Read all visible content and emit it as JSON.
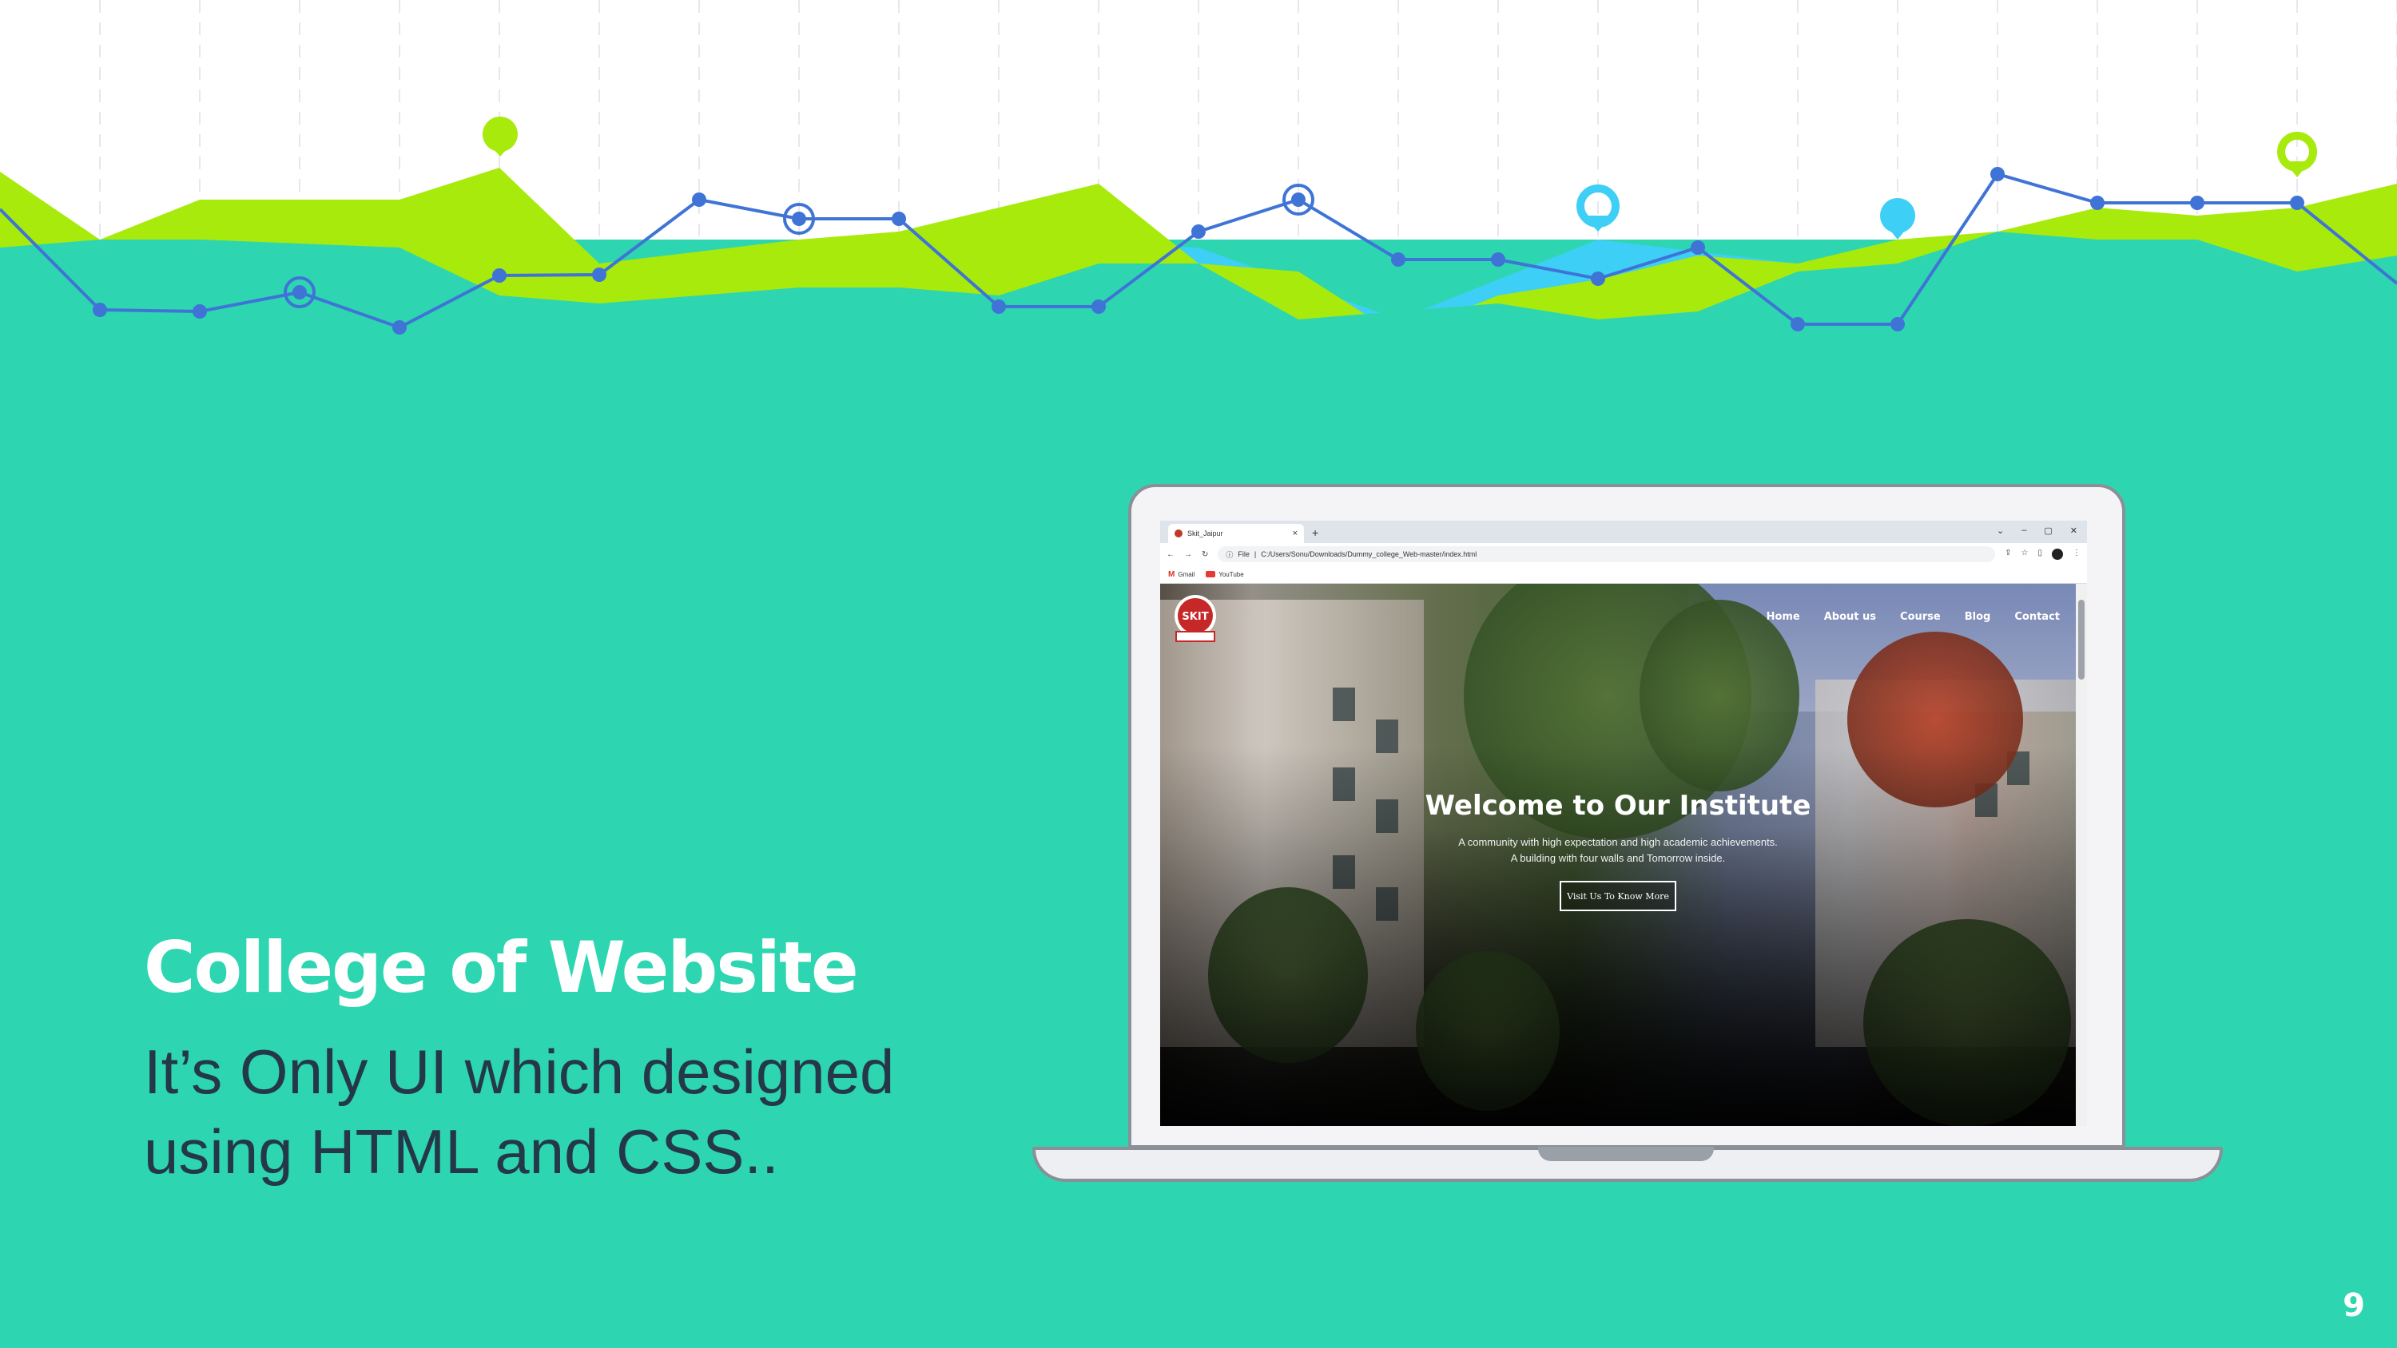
{
  "slide": {
    "title": "College of Website",
    "subtitle_line1": "It’s Only UI which designed",
    "subtitle_line2": "using HTML and CSS..",
    "page_number": "9"
  },
  "colors": {
    "background": "#2dd6b0",
    "lime": "#a8ea0b",
    "sky": "#3dcff5",
    "line": "#3f74d6",
    "subtitle_text": "#24384a"
  },
  "browser": {
    "tab_title": "Skit_Jaipur",
    "tab_close": "×",
    "new_tab": "+",
    "window_controls": [
      "⌄",
      "–",
      "▢",
      "✕"
    ],
    "address_prefix": "File",
    "address": "C:/Users/Sonu/Downloads/Dummy_college_Web-master/index.html",
    "bookmarks": [
      "Gmail",
      "YouTube"
    ]
  },
  "website": {
    "logo_text": "SKIT",
    "nav": [
      "Home",
      "About us",
      "Course",
      "Blog",
      "Contact"
    ],
    "hero_title": "Welcome to Our Institute",
    "hero_text": "A community with high expectation and high academic achievements. A building with four walls and Tomorrow inside.",
    "hero_button": "Visit Us To Know More"
  }
}
